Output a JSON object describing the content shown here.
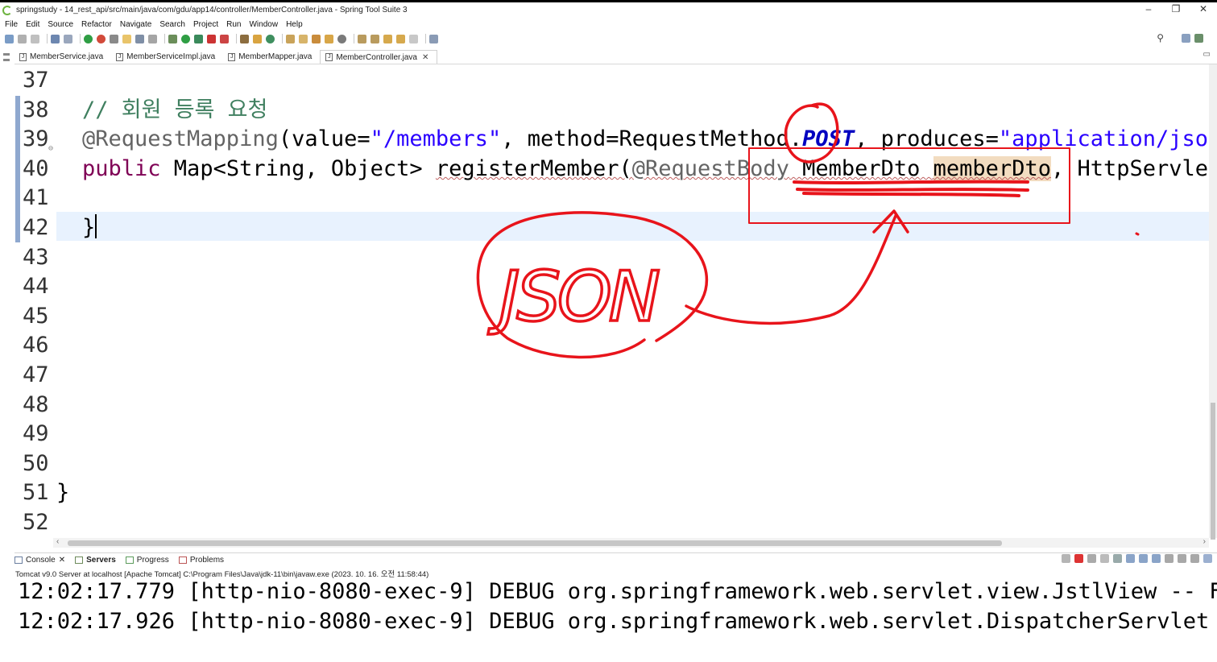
{
  "window": {
    "title": "springstudy - 14_rest_api/src/main/java/com/gdu/app14/controller/MemberController.java - Spring Tool Suite 3",
    "controls": [
      "–",
      "❐",
      "✕"
    ]
  },
  "menu": [
    "File",
    "Edit",
    "Source",
    "Refactor",
    "Navigate",
    "Search",
    "Project",
    "Run",
    "Window",
    "Help"
  ],
  "tabs": [
    {
      "label": "MemberService.java",
      "active": false
    },
    {
      "label": "MemberServiceImpl.java",
      "active": false
    },
    {
      "label": "MemberMapper.java",
      "active": false
    },
    {
      "label": "MemberController.java",
      "active": true
    }
  ],
  "editor": {
    "lines": [
      {
        "n": "37",
        "parts": []
      },
      {
        "n": "38",
        "parts": [
          {
            "t": "// 회원 등록 요청",
            "c": "cm"
          }
        ]
      },
      {
        "n": "39",
        "parts": [
          {
            "t": "@RequestMapping",
            "c": "ann"
          },
          {
            "t": "(value=",
            "c": ""
          },
          {
            "t": "\"/members\"",
            "c": "str"
          },
          {
            "t": ", method=RequestMethod.",
            "c": ""
          },
          {
            "t": "POST",
            "c": "post"
          },
          {
            "t": ", produces=",
            "c": ""
          },
          {
            "t": "\"application/json\"",
            "c": "str"
          }
        ]
      },
      {
        "n": "40",
        "parts": [
          {
            "t": "public",
            "c": "kw"
          },
          {
            "t": " Map<String, Object> ",
            "c": ""
          },
          {
            "t": "registerMember(",
            "c": "warn"
          },
          {
            "t": "@RequestBody",
            "c": "ann warn"
          },
          {
            "t": " MemberDto ",
            "c": "warn"
          },
          {
            "t": "memberDto",
            "c": "hl warn"
          },
          {
            "t": ", HttpServletR",
            "c": ""
          }
        ]
      },
      {
        "n": "41",
        "parts": []
      },
      {
        "n": "42",
        "parts": [
          {
            "t": "}",
            "c": ""
          }
        ]
      },
      {
        "n": "43",
        "parts": []
      },
      {
        "n": "44",
        "parts": []
      },
      {
        "n": "45",
        "parts": []
      },
      {
        "n": "46",
        "parts": []
      },
      {
        "n": "47",
        "parts": []
      },
      {
        "n": "48",
        "parts": []
      },
      {
        "n": "49",
        "parts": []
      },
      {
        "n": "50",
        "parts": []
      },
      {
        "n": "51",
        "parts": [
          {
            "t": "}",
            "c": ""
          }
        ]
      },
      {
        "n": "52",
        "parts": []
      }
    ]
  },
  "bottom_panel": {
    "tabs": [
      "Console",
      "Servers",
      "Progress",
      "Problems"
    ],
    "description": "Tomcat v9.0 Server at localhost [Apache Tomcat] C:\\Program Files\\Java\\jdk-11\\bin\\javaw.exe  (2023. 10. 16. 오전 11:58:44)",
    "lines": [
      "12:02:17.779 [http-nio-8080-exec-9] DEBUG org.springframework.web.servlet.view.JstlView -- For",
      "12:02:17.926 [http-nio-8080-exec-9] DEBUG org.springframework.web.servlet.DispatcherServlet --"
    ]
  },
  "annotation": {
    "handwritten_text": "JSON",
    "ink_color": "#e8141b"
  }
}
